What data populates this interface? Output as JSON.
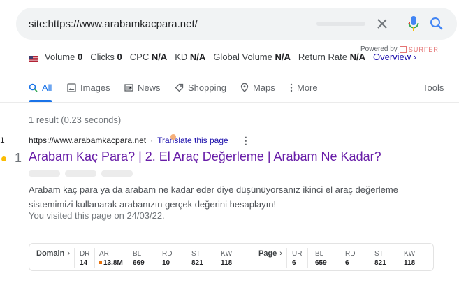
{
  "search": {
    "query": "site:https://www.arabamkacpara.net/"
  },
  "keyword_metrics": {
    "volume_label": "Volume",
    "volume_value": "0",
    "clicks_label": "Clicks",
    "clicks_value": "0",
    "cpc_label": "CPC",
    "cpc_value": "N/A",
    "kd_label": "KD",
    "kd_value": "N/A",
    "global_volume_label": "Global Volume",
    "global_volume_value": "N/A",
    "return_rate_label": "Return Rate",
    "return_rate_value": "N/A",
    "overview_link": "Overview ›",
    "powered_by": "Powered by",
    "surfer": "SURFER"
  },
  "tabs": [
    {
      "label": "All",
      "icon": "search-icon",
      "active": true
    },
    {
      "label": "Images",
      "icon": "image-icon"
    },
    {
      "label": "News",
      "icon": "news-icon"
    },
    {
      "label": "Shopping",
      "icon": "tag-icon"
    },
    {
      "label": "Maps",
      "icon": "map-pin-icon"
    },
    {
      "label": "More",
      "icon": "more-vert-icon"
    },
    {
      "label": "Tools"
    }
  ],
  "result_count": "1 result (0.23 seconds)",
  "result": {
    "side_number_small": "1",
    "side_number_big": "1",
    "url": "https://www.arabamkacpara.net",
    "separator": "·",
    "translate": "Translate this page",
    "title": "Arabam Kaç Para? | 2. El Araç Değerleme | Arabam Ne Kadar?",
    "snippet": "Arabam kaç para ya da arabam ne kadar eder diye düşünüyorsanız ikinci el araç değerleme sistemimizi kullanarak arabanızın gerçek değerini hesaplayın!",
    "visited": "You visited this page on 24/03/22."
  },
  "metrics": {
    "domain_label": "Domain",
    "page_label": "Page",
    "domain": [
      {
        "name": "DR",
        "value": "14"
      },
      {
        "name": "AR",
        "value": "13.8M"
      },
      {
        "name": "BL",
        "value": "669"
      },
      {
        "name": "RD",
        "value": "10"
      },
      {
        "name": "ST",
        "value": "821"
      },
      {
        "name": "KW",
        "value": "118"
      }
    ],
    "page": [
      {
        "name": "UR",
        "value": "6"
      },
      {
        "name": "BL",
        "value": "659"
      },
      {
        "name": "RD",
        "value": "6"
      },
      {
        "name": "ST",
        "value": "821"
      },
      {
        "name": "KW",
        "value": "118"
      }
    ]
  },
  "colors": {
    "link_blue": "#1a0dab",
    "visited_purple": "#681da8",
    "active_tab": "#1a73e8",
    "ar_marker": "#e8710a",
    "rank_dot": "#fbbc04"
  }
}
